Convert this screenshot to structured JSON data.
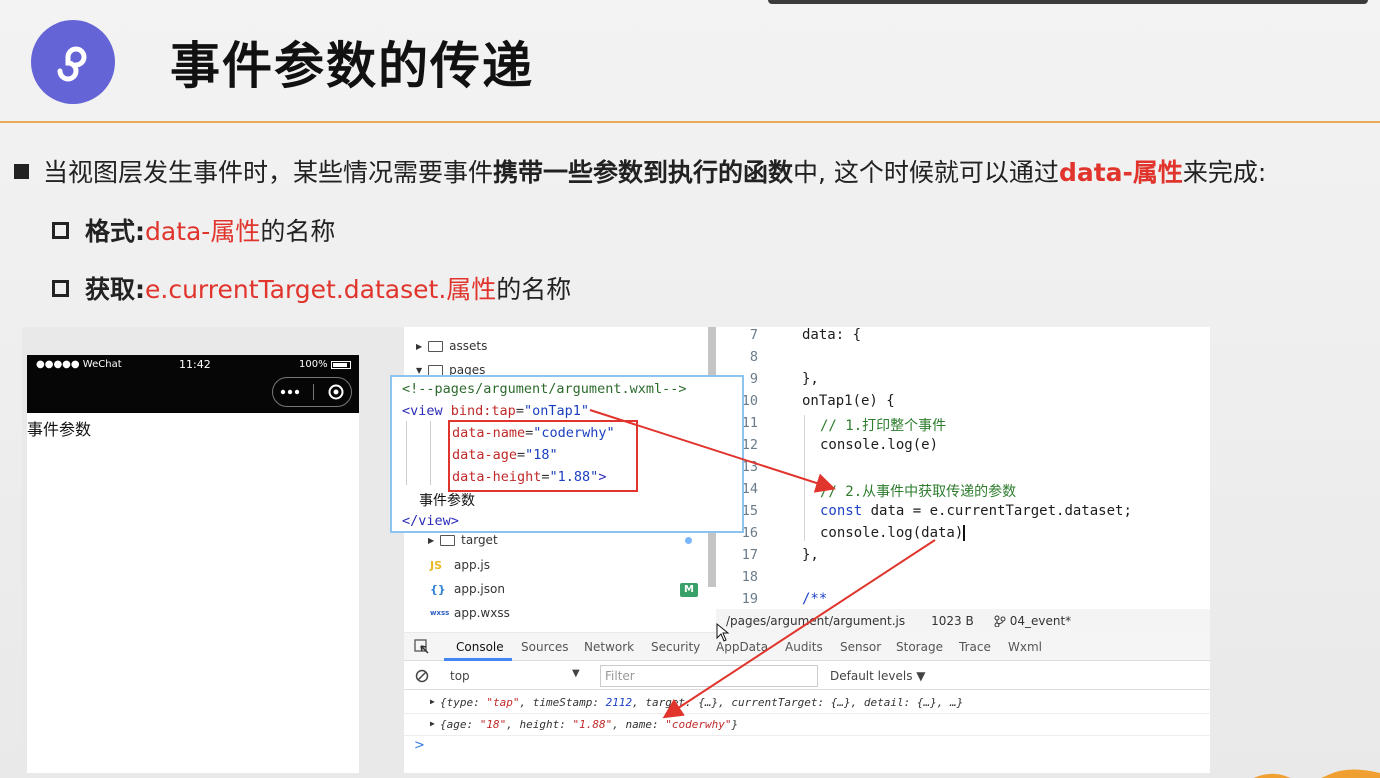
{
  "slide": {
    "title": "事件参数的传递",
    "bullet": {
      "text_before": "当视图层发生事件时，某些情况需要事件",
      "bold_text": "携带一些参数到执行的函数",
      "text_mid": "中, 这个时候就可以通过",
      "highlight": "data-属性",
      "text_after": "来完成:"
    },
    "format": {
      "label": "格式:",
      "highlight": "data-属性",
      "suffix": "的名称"
    },
    "get": {
      "label": "获取:",
      "highlight": "e.currentTarget.dataset.属性",
      "suffix": "的名称"
    }
  },
  "phone": {
    "carrier": "●●●●● WeChat",
    "time": "11:42",
    "battery": "100%",
    "page_text": "事件参数"
  },
  "file_tree": {
    "items": [
      {
        "name": "assets",
        "type": "folder"
      },
      {
        "name": "pages",
        "type": "folder"
      },
      {
        "name": "target",
        "type": "folder"
      },
      {
        "name": "app.js",
        "type": "js",
        "icon": "JS"
      },
      {
        "name": "app.json",
        "type": "json",
        "icon": "{}"
      },
      {
        "name": "app.wxss",
        "type": "wxss",
        "icon": "wxss"
      }
    ],
    "badge": "M"
  },
  "wxml_popup": {
    "comment": "<!--pages/argument/argument.wxml-->",
    "tag_open": "<view",
    "bind_attr": "bind:tap",
    "bind_value": "\"onTap1\"",
    "attr1": "data-name",
    "val1": "\"coderwhy\"",
    "attr2": "data-age",
    "val2": "\"18\"",
    "attr3": "data-height",
    "val3": "\"1.88\"",
    "close_bracket": ">",
    "inner_text": "事件参数",
    "tag_close": "</view>"
  },
  "editor": {
    "line_numbers": [
      "7",
      "8",
      "9",
      "10",
      "11",
      "12",
      "13",
      "14",
      "15",
      "16",
      "17",
      "18",
      "19"
    ],
    "lines": {
      "l7": "data: {",
      "l9": "},",
      "l10": "onTap1(e) {",
      "l11": "// 1.打印整个事件",
      "l12": "console.log(e)",
      "l14": "// 2.从事件中获取传递的参数",
      "l15_kw": "const",
      "l15_rest": " data = e.currentTarget.dataset;",
      "l16": "console.log(data)",
      "l17": "},",
      "l19": "/**"
    }
  },
  "statusbar": {
    "path": "/pages/argument/argument.js",
    "size": "1023 B",
    "branch": "04_event*"
  },
  "devtools": {
    "tabs": [
      "Console",
      "Sources",
      "Network",
      "Security",
      "AppData",
      "Audits",
      "Sensor",
      "Storage",
      "Trace",
      "Wxml"
    ],
    "active_tab": "Console",
    "context": "top",
    "filter_placeholder": "Filter",
    "levels": "Default levels ▼",
    "log1": {
      "p1": "{type: ",
      "v1": "\"tap\"",
      "p2": ", timeStamp: ",
      "v2": "2112",
      "p3": ", target: {…}, currentTarget: {…}, detail: {…}, …}"
    },
    "log2": {
      "p1": "{age: ",
      "v1": "\"18\"",
      "p2": ", height: ",
      "v2": "\"1.88\"",
      "p3": ", name: ",
      "v3": "\"coderwhy\"",
      "p4": "}"
    },
    "prompt": ">"
  },
  "colors": {
    "accent_red": "#e0342c",
    "logo_purple": "#6464d6",
    "rule_orange": "#e8a95a",
    "active_tab_blue": "#4286f4"
  }
}
